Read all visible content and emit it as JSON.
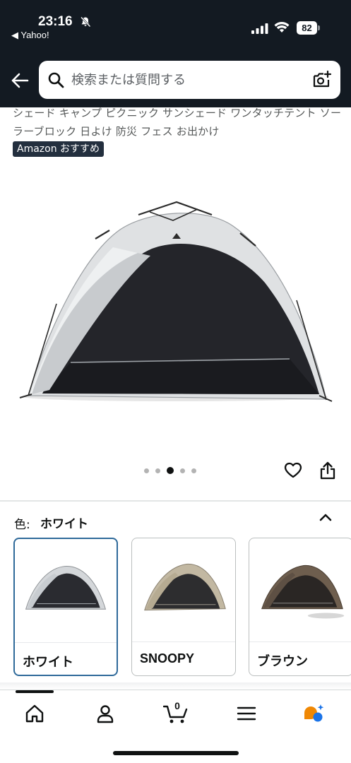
{
  "status_bar": {
    "time": "23:16",
    "back_app": "◀ Yahoo!",
    "battery": "82"
  },
  "header": {
    "search_placeholder": "検索または質問する",
    "accent_color": "#131a22"
  },
  "product": {
    "title": "シェード キャンプ ピクニック サンシェード ワンタッチテント ソーラーブロック 日よけ 防災 フェス お出かけ",
    "badge": "Amazon おすすめ",
    "image_count": 5,
    "active_image_index": 2
  },
  "variation": {
    "label": "色:",
    "selected": "ホワイト",
    "options": [
      {
        "label": "ホワイト",
        "color": "#c9cdd0",
        "selected": true
      },
      {
        "label": "SNOOPY",
        "color": "#b7ad97",
        "selected": false
      },
      {
        "label": "ブラウン",
        "color": "#6a5a4a",
        "selected": false
      }
    ]
  },
  "tab_bar": {
    "items": [
      "home-icon",
      "account-icon",
      "cart-icon",
      "menu-icon",
      "rufus-icon"
    ],
    "cart_count": "0"
  }
}
